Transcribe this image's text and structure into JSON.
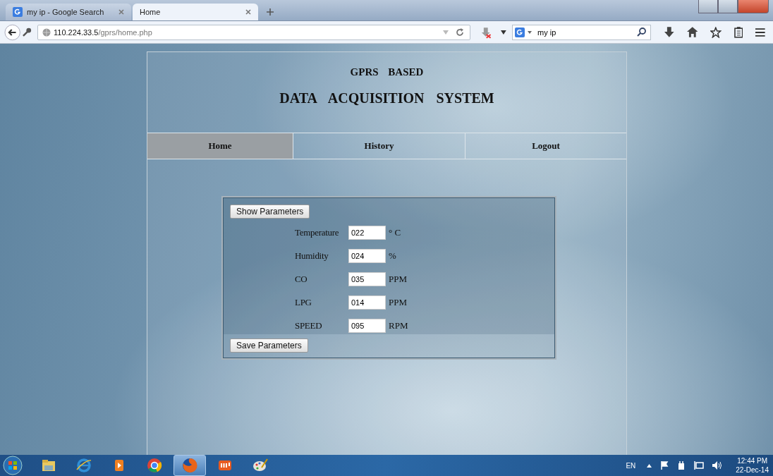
{
  "browser": {
    "tabs": [
      {
        "title": "my ip - Google Search",
        "selected": false
      },
      {
        "title": "Home",
        "selected": true
      }
    ],
    "url_host": "110.224.33.5",
    "url_path": "/gprs/home.php",
    "search": {
      "value": "my ip"
    }
  },
  "page": {
    "title_line1": "GPRS BASED",
    "title_line2": "DATA ACQUISITION SYSTEM",
    "nav": [
      {
        "label": "Home",
        "selected": true
      },
      {
        "label": "History",
        "selected": false
      },
      {
        "label": "Logout",
        "selected": false
      }
    ],
    "form": {
      "show_button": "Show Parameters",
      "save_button": "Save Parameters",
      "parameters": [
        {
          "label": "Temperature",
          "value": "022",
          "unit": "° C"
        },
        {
          "label": "Humidity",
          "value": "024",
          "unit": "%"
        },
        {
          "label": "CO",
          "value": "035",
          "unit": "PPM"
        },
        {
          "label": "LPG",
          "value": "014",
          "unit": "PPM"
        },
        {
          "label": "SPEED",
          "value": "095",
          "unit": "RPM"
        }
      ]
    }
  },
  "taskbar": {
    "apps": [
      {
        "selected": false
      },
      {
        "selected": false
      },
      {
        "selected": false
      },
      {
        "selected": false
      },
      {
        "selected": true
      },
      {
        "selected": false
      },
      {
        "selected": false
      }
    ],
    "language": "EN",
    "time": "12:44 PM",
    "date": "22-Dec-14"
  }
}
